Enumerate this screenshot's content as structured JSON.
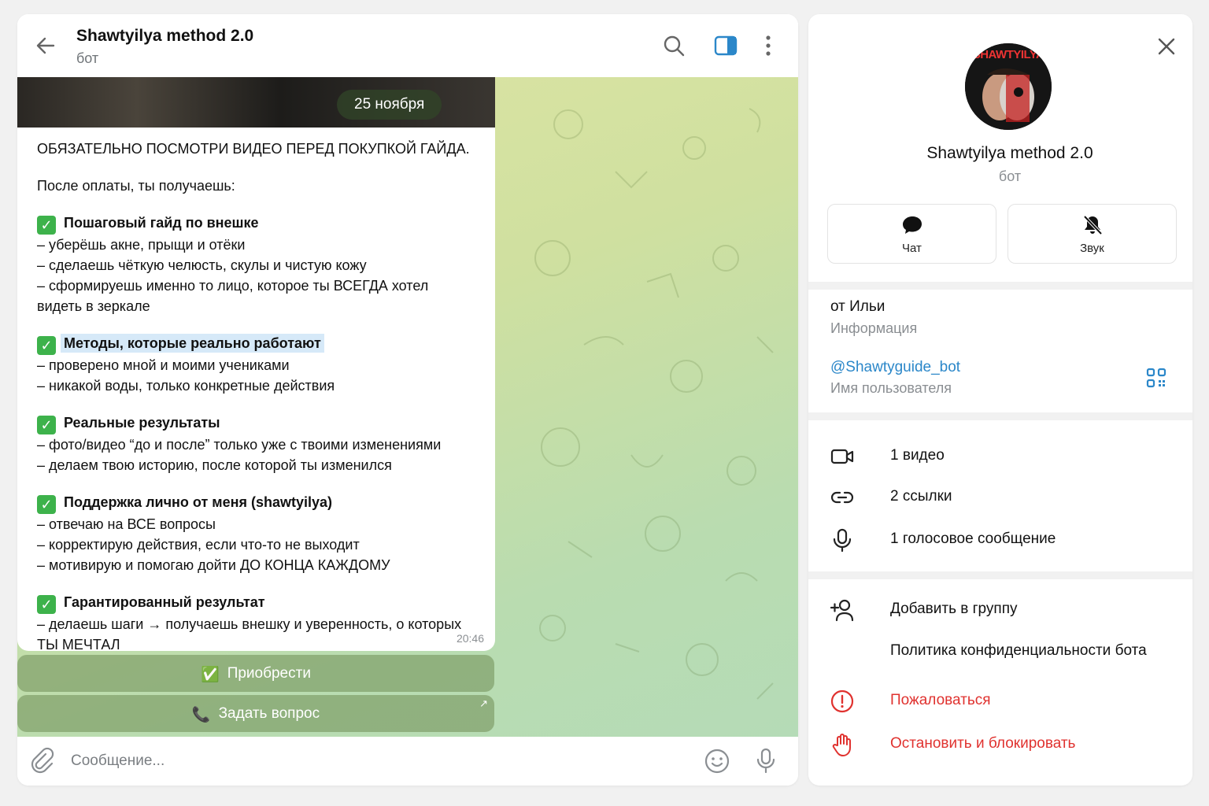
{
  "header": {
    "title": "Shawtyilya method 2.0",
    "subtitle": "бот"
  },
  "chat": {
    "date": "25 ноября",
    "message": {
      "intro": "ОБЯЗАТЕЛЬНО ПОСМОТРИ ВИДЕО ПЕРЕД ПОКУПКОЙ ГАЙДА.",
      "lead": "После оплаты, ты получаешь:",
      "sections": [
        {
          "title": "Пошаговый гайд по внешке",
          "lines": [
            "– уберёшь акне, прыщи и отёки",
            "– сделаешь чёткую челюсть, скулы и чистую кожу",
            "– сформируешь именно то лицо, которое ты ВСЕГДА хотел",
            "видеть в зеркале"
          ]
        },
        {
          "title": "Методы, которые реально работают",
          "lines": [
            "– проверено мной и моими учениками",
            "– никакой воды, только конкретные действия"
          ]
        },
        {
          "title": "Реальные результаты",
          "lines": [
            "– фото/видео “до и после” только уже с твоими изменениями",
            "– делаем твою историю, после которой ты изменился"
          ]
        },
        {
          "title": "Поддержка лично от меня (shawtyilya)",
          "lines": [
            "– отвечаю на ВСЕ вопросы",
            "– корректирую действия, если что-то не выходит",
            "– мотивирую и помогаю дойти ДО КОНЦА КАЖДОМУ"
          ]
        },
        {
          "title": "Гарантированный результат",
          "lines": [
            "– делаешь шаги → получаешь внешку и уверенность, о которых",
            "ТЫ МЕЧТАЛ"
          ]
        }
      ],
      "time": "20:46"
    },
    "buttons": [
      {
        "emoji": "✅",
        "label": "Приобрести"
      },
      {
        "emoji": "📞",
        "label": "Задать вопрос",
        "corner": "↗"
      }
    ]
  },
  "composer": {
    "placeholder": "Сообщение..."
  },
  "info": {
    "avatar_text": "SHAWTYILYA",
    "name": "Shawtyilya method 2.0",
    "subtitle": "бот",
    "actions": {
      "chat": "Чат",
      "sound": "Звук"
    },
    "about": {
      "value": "от Ильи",
      "label": "Информация"
    },
    "username": {
      "value": "@Shawtyguide_bot",
      "label": "Имя пользователя"
    },
    "media": {
      "video": "1 видео",
      "links": "2 ссылки",
      "voice": "1 голосовое сообщение"
    },
    "add_group": "Добавить в группу",
    "privacy": "Политика конфиденциальности бота",
    "report": "Пожаловаться",
    "block": "Остановить и блокировать"
  },
  "colors": {
    "accent": "#2b87c9",
    "danger": "#e0322f",
    "check_green": "#3db24b",
    "keyboard_button": "#7f9a66"
  }
}
